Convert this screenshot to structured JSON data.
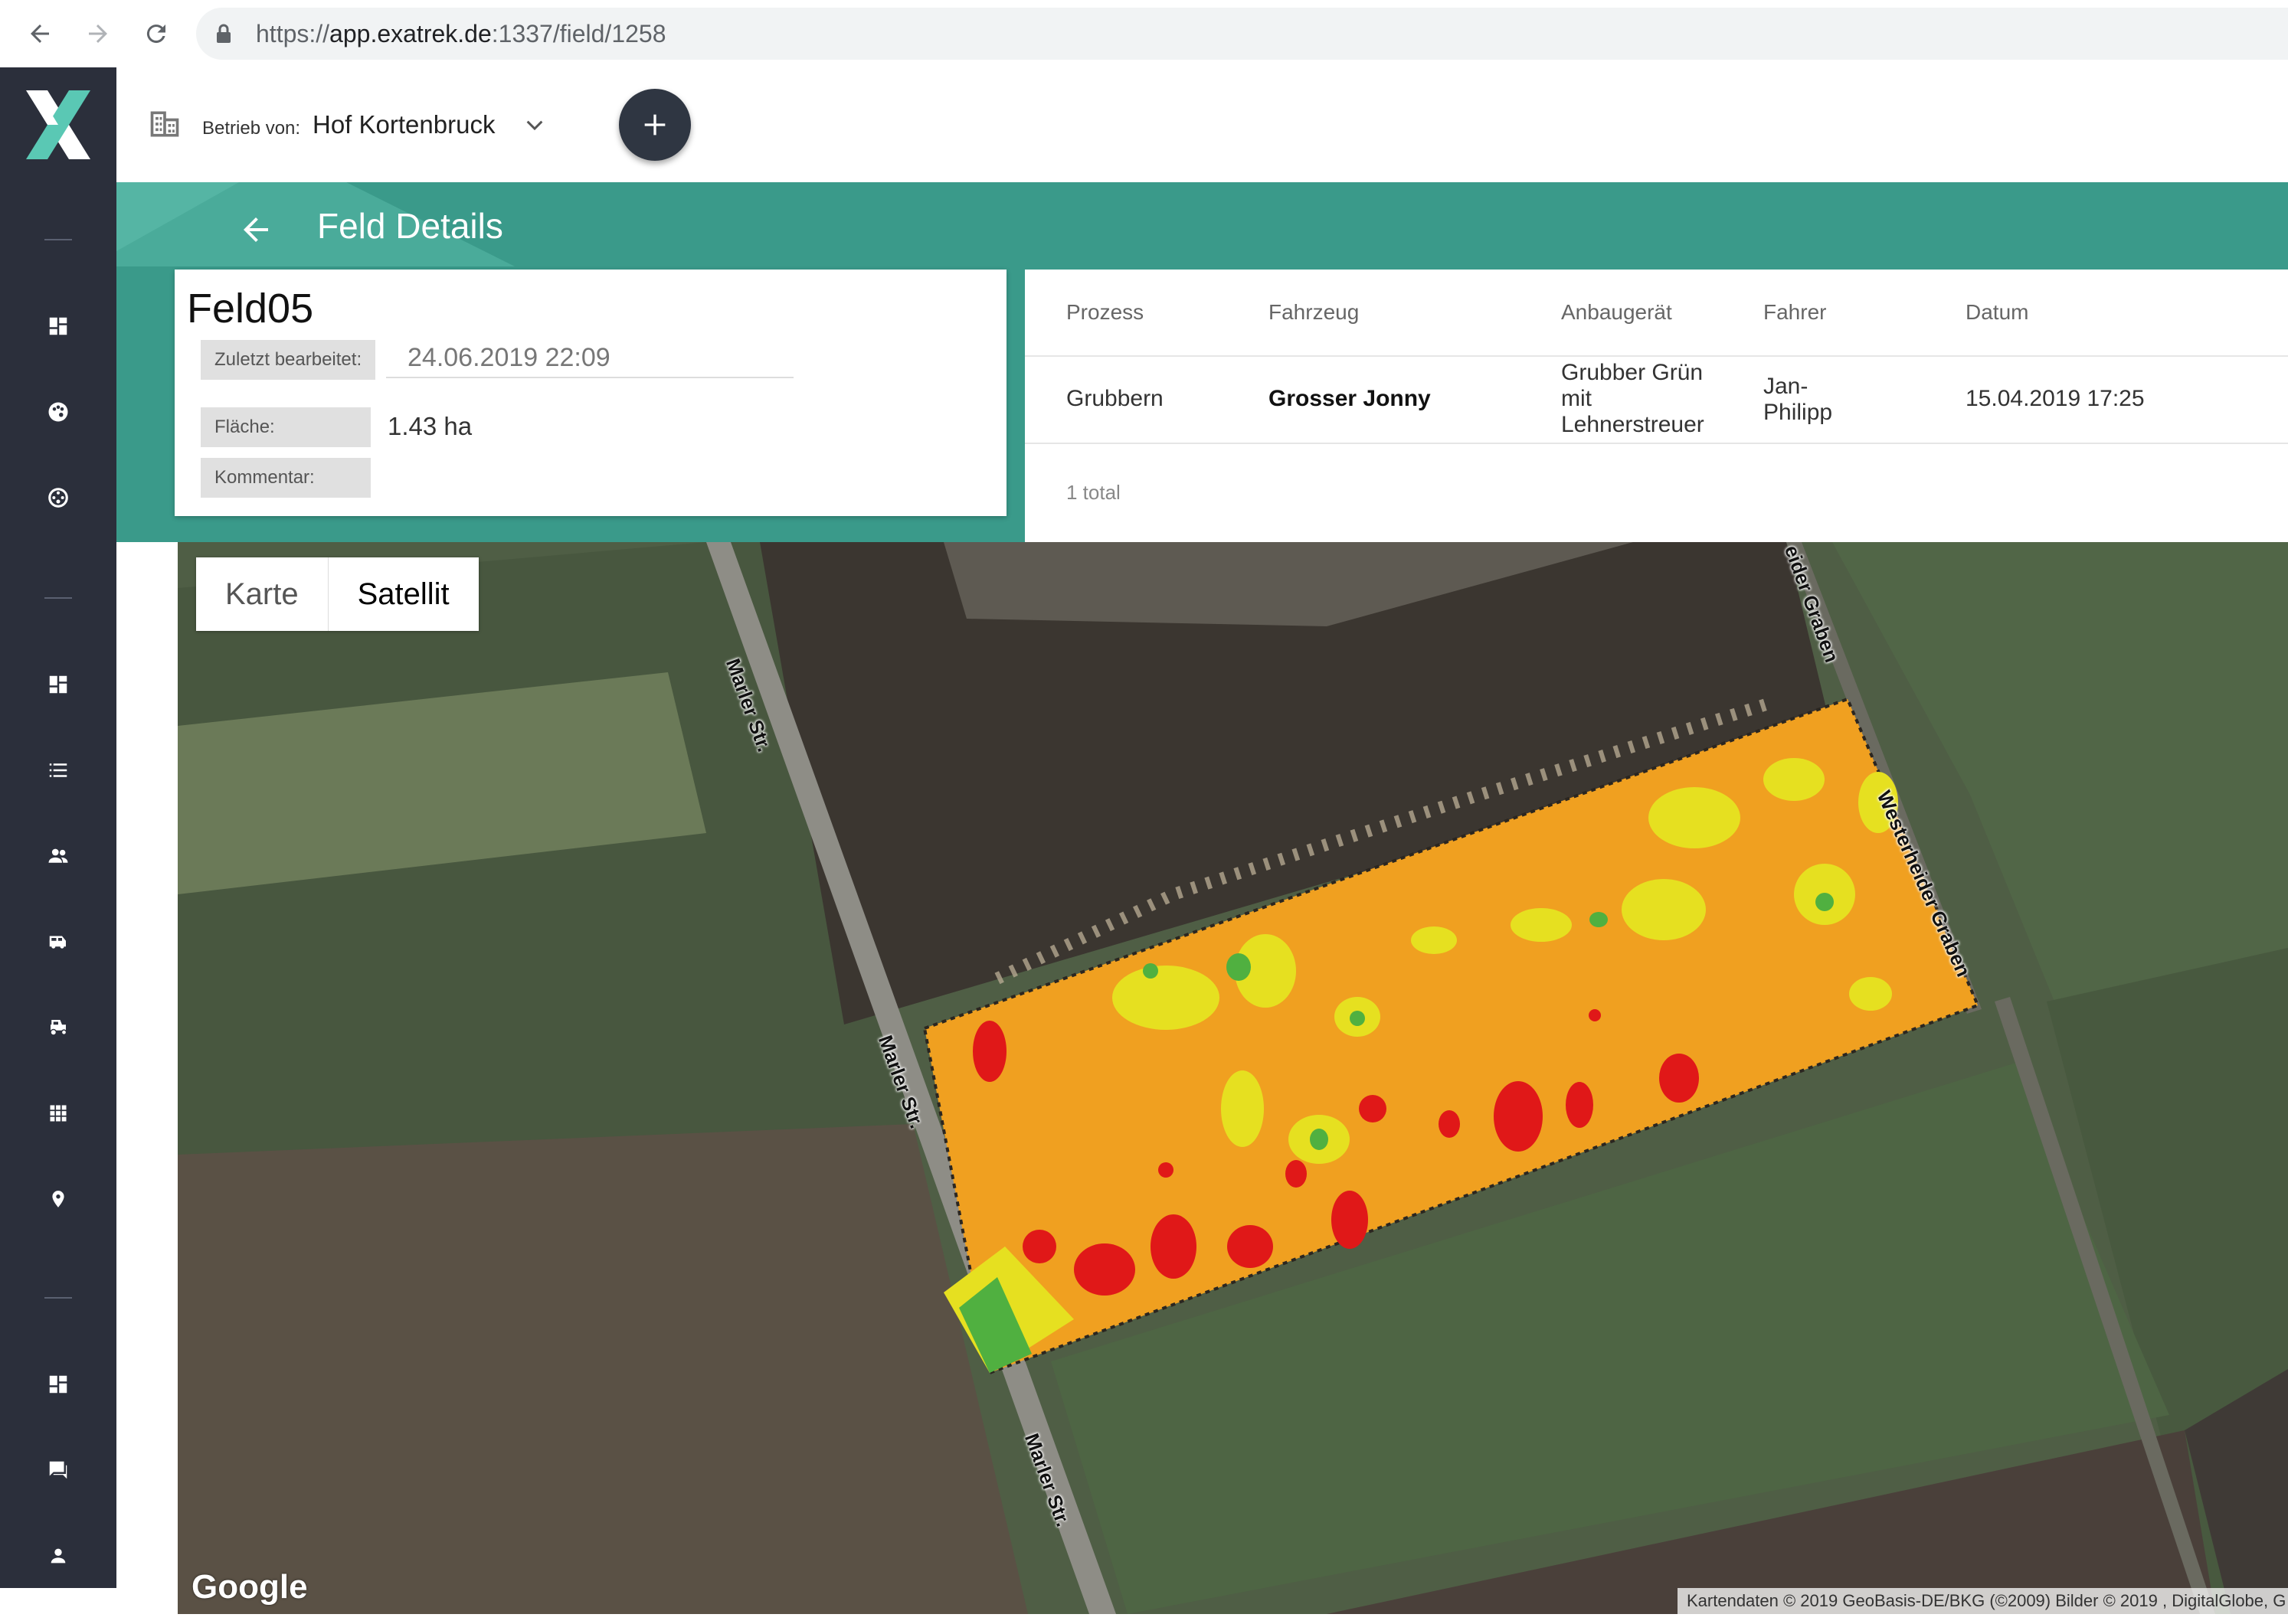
{
  "browser": {
    "url_prefix": "https://",
    "url_host": "app.exatrek.de",
    "url_path": ":1337/field/1258"
  },
  "header": {
    "betrieb_label": "Betrieb von:",
    "betrieb_value": "Hof Kortenbruck"
  },
  "page": {
    "title": "Feld Details"
  },
  "field": {
    "name": "Feld05",
    "edited_label": "Zuletzt bearbeitet:",
    "edited_value": "24.06.2019 22:09",
    "area_label": "Fläche:",
    "area_value": "1.43 ha",
    "comment_label": "Kommentar:"
  },
  "table": {
    "columns": [
      "Prozess",
      "Fahrzeug",
      "Anbaugerät",
      "Fahrer",
      "Datum"
    ],
    "rows": [
      {
        "prozess": "Grubbern",
        "fahrzeug": "Grosser Jonny",
        "anbaugeraet": "Grubber Grün mit Lehnerstreuer",
        "fahrer": "Jan-Philipp",
        "datum": "15.04.2019 17:25"
      }
    ],
    "total": "1 total"
  },
  "map": {
    "type_buttons": [
      "Karte",
      "Satellit"
    ],
    "active_type": "Satellit",
    "streets": [
      "Marler Str.",
      "Marler Str.",
      "Marler Str.",
      "eider Graben",
      "Westerheider Graben"
    ],
    "logo": "Google",
    "attribution": "Kartendaten © 2019 GeoBasis-DE/BKG (©2009) Bilder © 2019 , DigitalGlobe, G"
  },
  "colors": {
    "sidebar": "#2b2f3b",
    "teal": "#3a9a8a",
    "accent_green": "#5ac8b4",
    "heat_orange": "#f0a020",
    "heat_yellow": "#e6e020",
    "heat_red": "#e01818",
    "heat_green": "#50b040"
  },
  "sidebar_icons": [
    "dashboard-icon",
    "palette-icon",
    "settings-circle-icon",
    "dashboard-icon",
    "list-icon",
    "people-icon",
    "vehicle-icon",
    "tractor-icon",
    "grid-icon",
    "location-pin-icon",
    "dashboard-icon",
    "chat-icon",
    "person-icon"
  ]
}
